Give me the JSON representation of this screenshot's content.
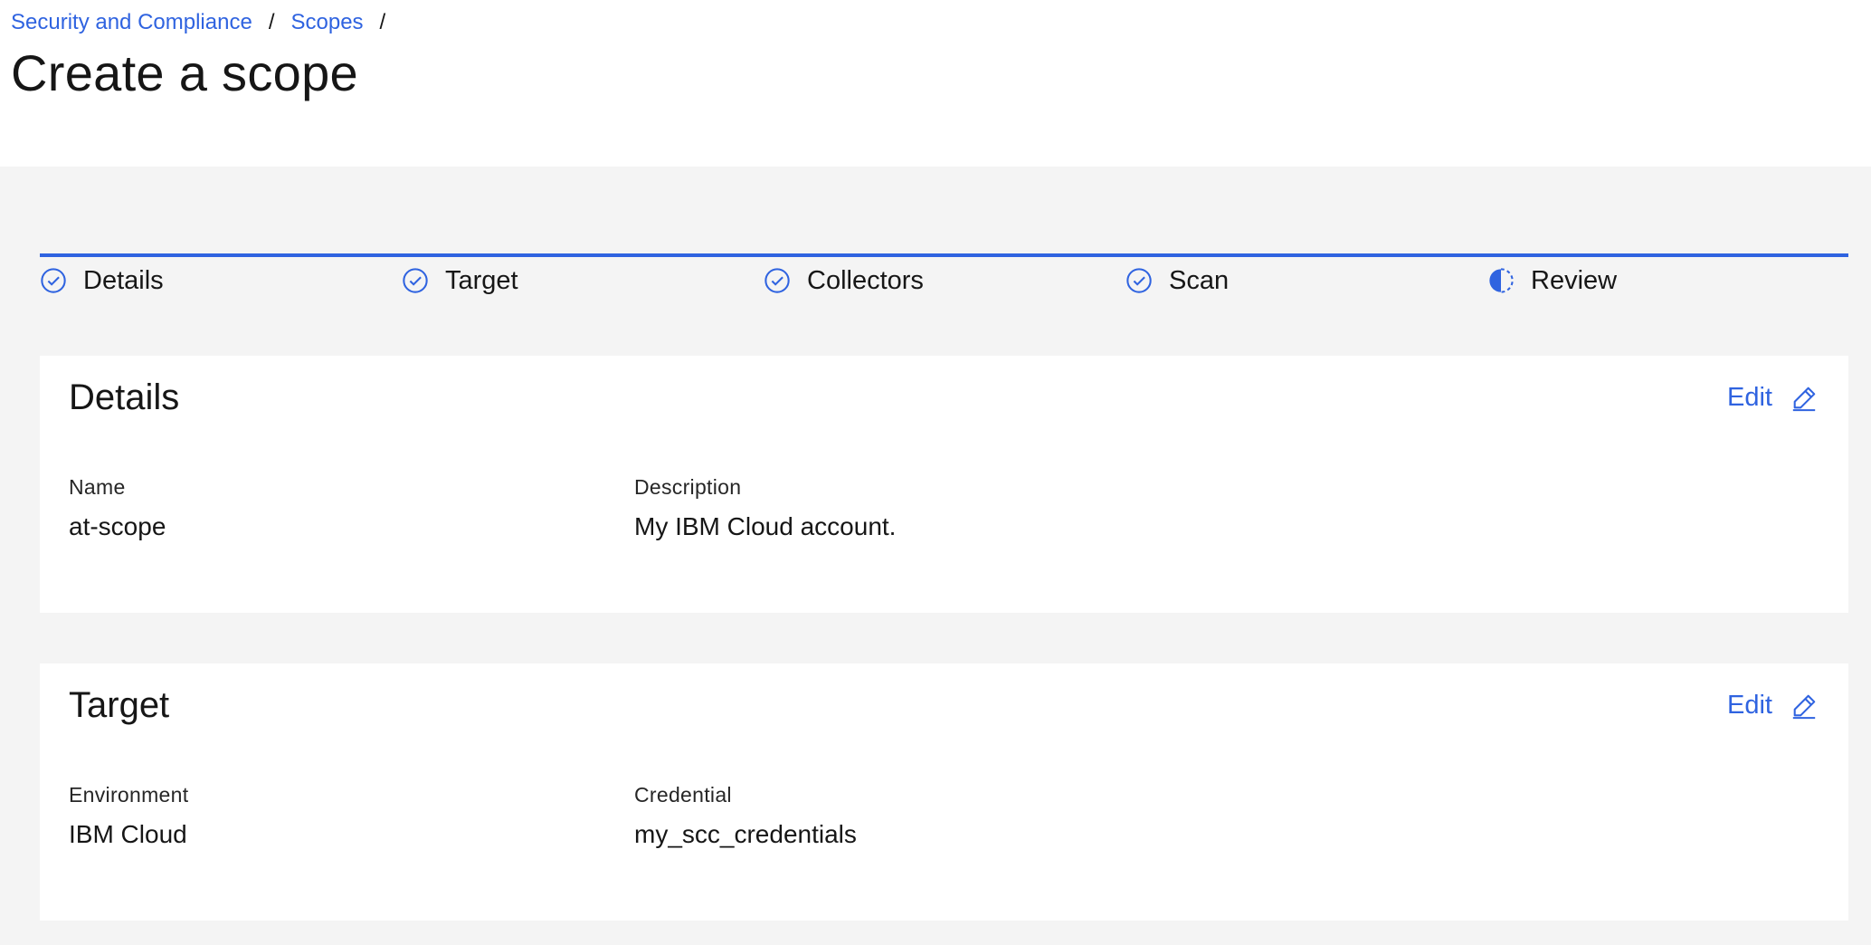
{
  "breadcrumb": {
    "items": [
      "Security and Compliance",
      "Scopes"
    ],
    "separator": "/"
  },
  "page": {
    "title": "Create a scope"
  },
  "progress": {
    "steps": [
      {
        "label": "Details",
        "state": "complete",
        "icon": "checkmark-outline-icon"
      },
      {
        "label": "Target",
        "state": "complete",
        "icon": "checkmark-outline-icon"
      },
      {
        "label": "Collectors",
        "state": "complete",
        "icon": "checkmark-outline-icon"
      },
      {
        "label": "Scan",
        "state": "complete",
        "icon": "checkmark-outline-icon"
      },
      {
        "label": "Review",
        "state": "current",
        "icon": "incomplete-half-icon"
      }
    ]
  },
  "details": {
    "title": "Details",
    "edit_label": "Edit",
    "fields": [
      {
        "label": "Name",
        "value": "at-scope"
      },
      {
        "label": "Description",
        "value": "My IBM Cloud account."
      }
    ]
  },
  "target": {
    "title": "Target",
    "edit_label": "Edit",
    "fields": [
      {
        "label": "Environment",
        "value": "IBM Cloud"
      },
      {
        "label": "Credential",
        "value": "my_scc_credentials"
      }
    ]
  },
  "colors": {
    "accent": "#2f63e0",
    "text": "#161616",
    "background": "#f4f4f4",
    "surface": "#ffffff"
  }
}
